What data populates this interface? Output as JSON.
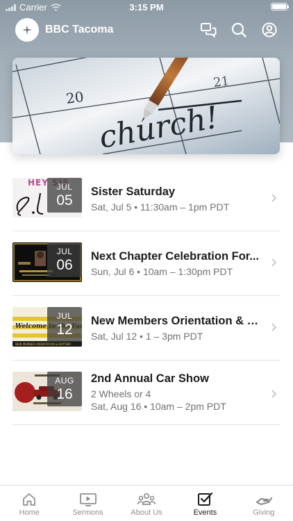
{
  "status_bar": {
    "carrier": "Carrier",
    "time": "3:15 PM"
  },
  "header": {
    "title": "BBC Tacoma"
  },
  "hero": {
    "calendar_numbers": [
      "20",
      "21"
    ],
    "handwritten": "church!"
  },
  "events": [
    {
      "title": "Sister Saturday",
      "lines": [
        "Sat, Jul 5 • 11:30am – 1pm PDT"
      ],
      "month": "JUL",
      "day": "05",
      "thumb_text": "HEY SIS"
    },
    {
      "title": "Next Chapter Celebration For...",
      "lines": [
        "Sun, Jul 6 • 10am – 1:30pm PDT"
      ],
      "month": "JUL",
      "day": "06"
    },
    {
      "title": "New Members Orientation & B...",
      "lines": [
        "Sat, Jul 12 • 1 – 3pm PDT"
      ],
      "month": "JUL",
      "day": "12",
      "thumb_text": "Welcome to the Family",
      "thumb_sub": "NEW MEMBER ORIENTATION & BAPTISM"
    },
    {
      "title": "2nd Annual Car Show",
      "lines": [
        "2 Wheels or 4",
        "Sat, Aug 16 • 10am – 2pm PDT"
      ],
      "month": "AUG",
      "day": "16"
    }
  ],
  "tabs": [
    {
      "label": "Home",
      "icon": "home-icon",
      "active": false
    },
    {
      "label": "Sermons",
      "icon": "play-icon",
      "active": false
    },
    {
      "label": "About Us",
      "icon": "people-icon",
      "active": false
    },
    {
      "label": "Events",
      "icon": "checkbox-icon",
      "active": true
    },
    {
      "label": "Giving",
      "icon": "giving-hand-icon",
      "active": false
    }
  ],
  "colors": {
    "header_gray": "#9aa7b2",
    "text_dark": "#1b1b1b",
    "text_muted": "#707070",
    "tab_inactive": "#8e8e8e"
  }
}
